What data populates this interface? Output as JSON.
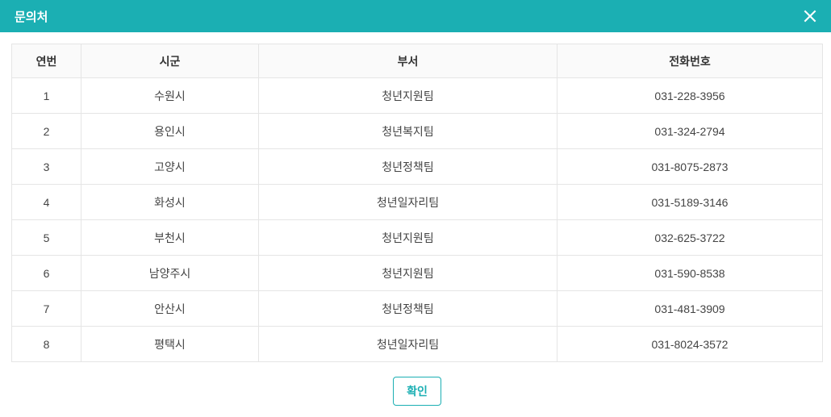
{
  "header": {
    "title": "문의처"
  },
  "table": {
    "headers": {
      "num": "연번",
      "city": "시군",
      "dept": "부서",
      "phone": "전화번호"
    },
    "rows": [
      {
        "num": "1",
        "city": "수원시",
        "dept": "청년지원팀",
        "phone": "031-228-3956"
      },
      {
        "num": "2",
        "city": "용인시",
        "dept": "청년복지팀",
        "phone": "031-324-2794"
      },
      {
        "num": "3",
        "city": "고양시",
        "dept": "청년정책팀",
        "phone": "031-8075-2873"
      },
      {
        "num": "4",
        "city": "화성시",
        "dept": "청년일자리팀",
        "phone": "031-5189-3146"
      },
      {
        "num": "5",
        "city": "부천시",
        "dept": "청년지원팀",
        "phone": "032-625-3722"
      },
      {
        "num": "6",
        "city": "남양주시",
        "dept": "청년지원팀",
        "phone": "031-590-8538"
      },
      {
        "num": "7",
        "city": "안산시",
        "dept": "청년정책팀",
        "phone": "031-481-3909"
      },
      {
        "num": "8",
        "city": "평택시",
        "dept": "청년일자리팀",
        "phone": "031-8024-3572"
      }
    ]
  },
  "footer": {
    "ok_label": "확인"
  }
}
